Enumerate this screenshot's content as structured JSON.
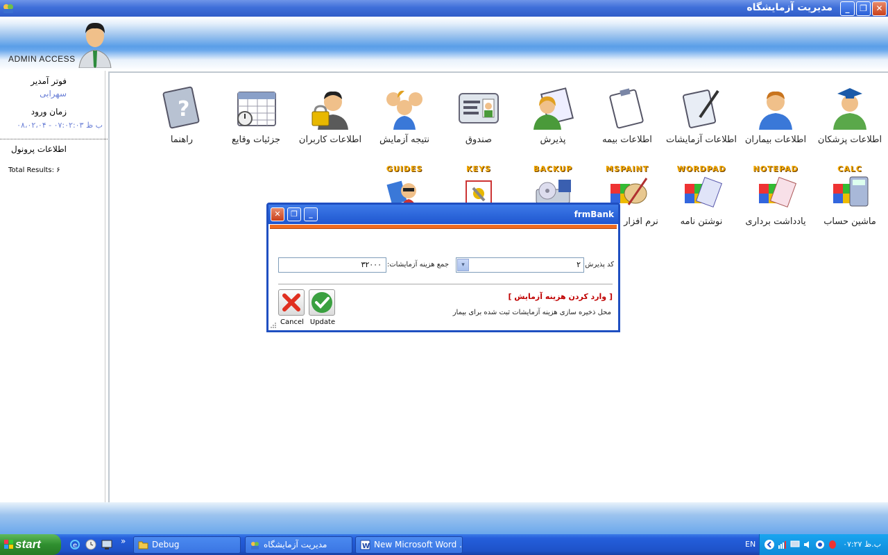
{
  "window": {
    "title": "مدیریت آزمایشگاه",
    "minimize_label": "_",
    "restore_label": "❐",
    "close_label": "✕"
  },
  "header": {
    "admin_access": "ADMIN ACCESS"
  },
  "left_panel": {
    "operator_label": "فوتر آمدیر",
    "operator_name": "سهرابی",
    "login_time_label": "زمان ورود",
    "login_time_value": "۰۸،۰۲،۰۴ - ۰۷:۰۲:۰۳ ب ظ",
    "files_info_label": "اطلاعات پرونول",
    "total_results": "Total Results: ۶"
  },
  "tiles_row1": [
    {
      "label": "اطلاعات پزشکان",
      "icon": "doctor-icon"
    },
    {
      "label": "اطلاعات بیماران",
      "icon": "patient-icon"
    },
    {
      "label": "اطلاعات آزمایشات",
      "icon": "clipboard-pen-icon"
    },
    {
      "label": "اطلاعات بیمه",
      "icon": "clipboard-icon"
    },
    {
      "label": "پذیرش",
      "icon": "reception-icon"
    },
    {
      "label": "صندوق",
      "icon": "id-card-icon"
    },
    {
      "label": "نتیجه آزمایش",
      "icon": "group-icon"
    },
    {
      "label": "اطلاعات کاربران",
      "icon": "user-lock-icon"
    },
    {
      "label": "جزئیات وقایع",
      "icon": "calendar-icon"
    },
    {
      "label": "راهنما",
      "icon": "help-book-icon"
    }
  ],
  "tiles_row2": [
    {
      "word": "CALC",
      "label": "ماشین حساب",
      "icon": "calculator-icon"
    },
    {
      "word": "NOTEPAD",
      "label": "یادداشت برداری",
      "icon": "notepad-icon"
    },
    {
      "word": "WORDPAD",
      "label": "نوشتن نامه",
      "icon": "wordpad-icon"
    },
    {
      "word": "MSPAINT",
      "label": "نرم افزار نقاشی",
      "icon": "paint-icon"
    },
    {
      "word": "BACKUP",
      "label": "",
      "icon": "backup-icon"
    },
    {
      "word": "KEYS",
      "label": "",
      "icon": "keys-icon"
    },
    {
      "word": "GUIDES",
      "label": "",
      "icon": "guides-icon"
    }
  ],
  "dialog": {
    "title": "frmBank",
    "admission_code_label": "کد پذیرش:",
    "admission_code_value": "۲",
    "total_cost_label": "جمع هزینه آزمایشات:",
    "total_cost_value": "۳۲۰۰۰",
    "heading": "[ وارد کردن هزینه آزمایش ]",
    "note": "محل ذخیره سازی هزینه آزمایشات ثبت شده برای بیمار",
    "update_label": "Update",
    "cancel_label": "Cancel",
    "dropdown_arrow": "▾"
  },
  "taskbar": {
    "start_label": "start",
    "chevron": "»",
    "tasks": [
      {
        "label": "Debug",
        "icon": "folder-icon"
      },
      {
        "label": "مدیریت آزمایشگاه",
        "icon": "app-icon"
      },
      {
        "label": "New Microsoft Word ...",
        "icon": "word-icon"
      }
    ],
    "language": "EN",
    "clock": "ب.ظ ۰۷:۲۷"
  }
}
